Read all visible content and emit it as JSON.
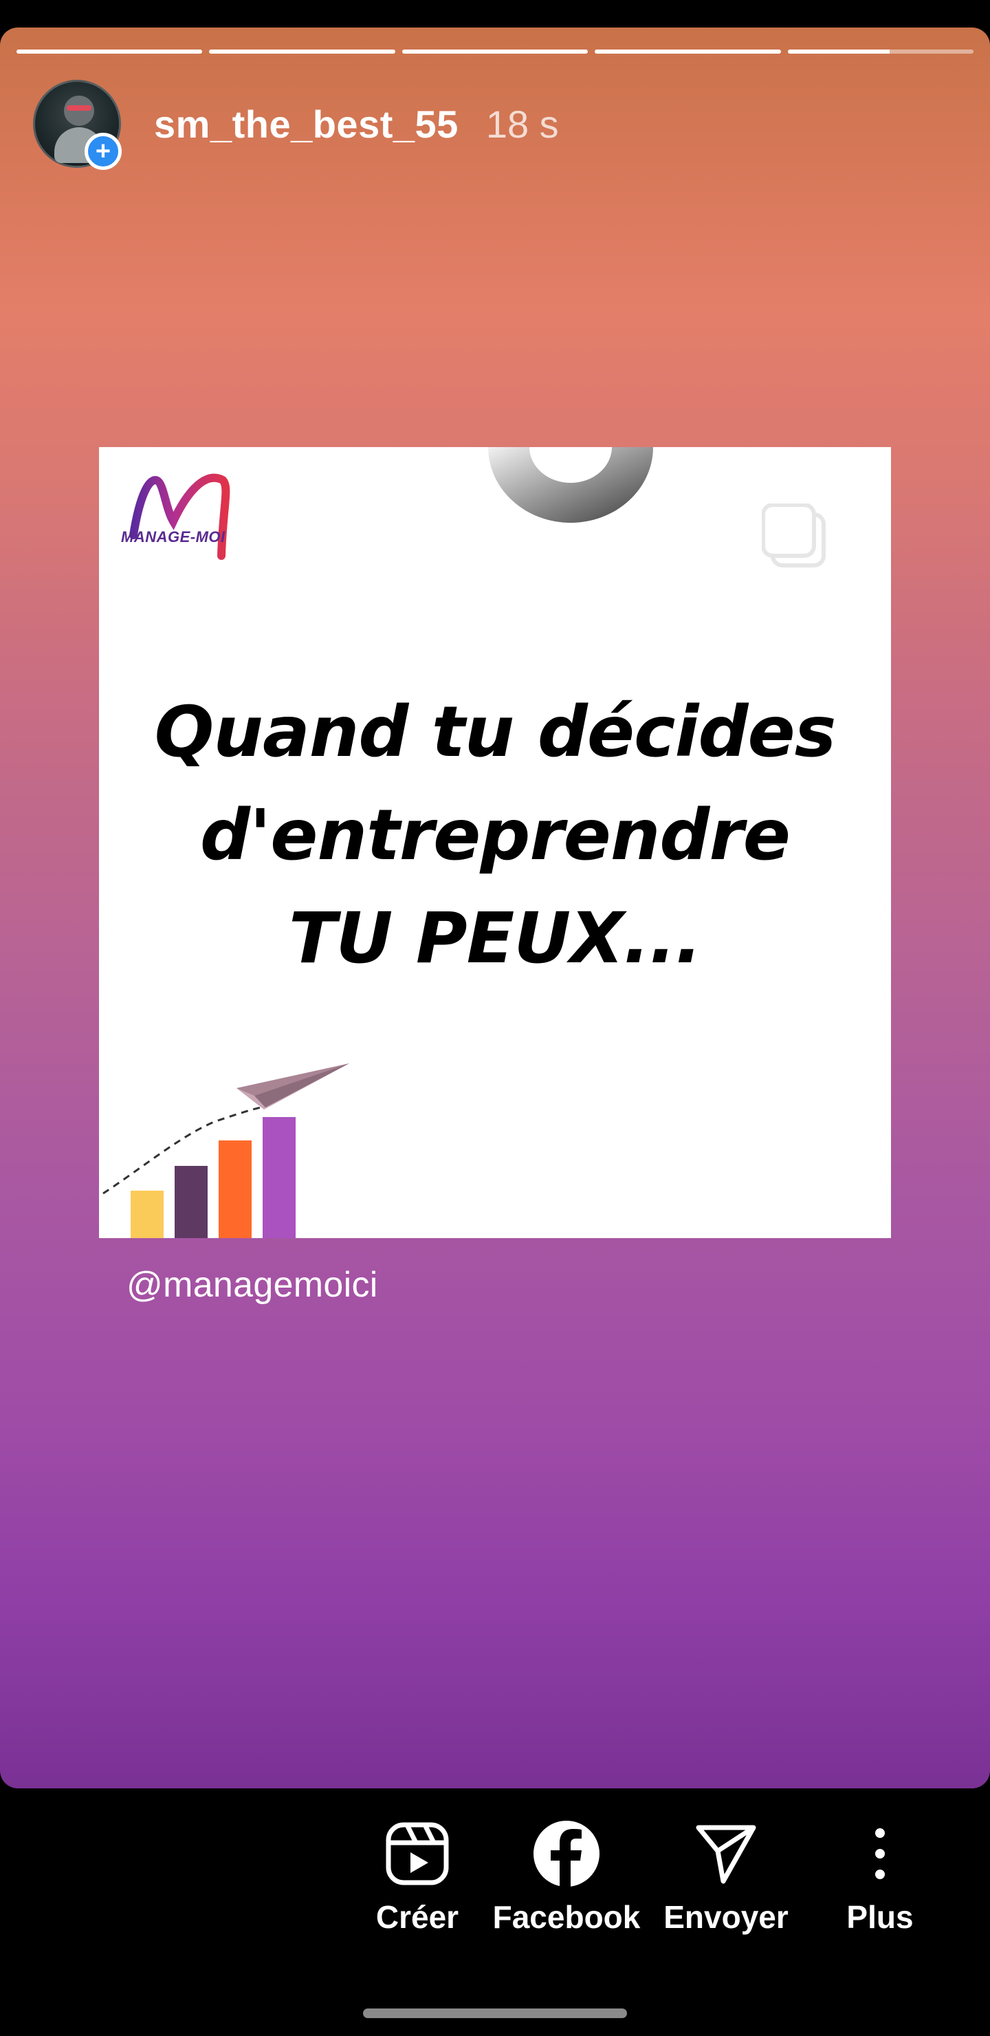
{
  "story": {
    "username": "sm_the_best_55",
    "time_ago": "18 s",
    "progress_segments": [
      1,
      1,
      1,
      1,
      0.55
    ],
    "avatar_badge": "+",
    "mention": "@managemoici"
  },
  "post": {
    "brand_logo_text": "MANAGE-MOI",
    "headline_lines": [
      "Quand tu décides",
      "d'entreprendre",
      "TU PEUX..."
    ],
    "chart_bar_colors": [
      "#fbcb5a",
      "#5e3a63",
      "#ff6a2b",
      "#a952c0"
    ]
  },
  "actions": [
    {
      "label": "Créer",
      "icon": "reels-icon"
    },
    {
      "label": "Facebook",
      "icon": "facebook-icon"
    },
    {
      "label": "Envoyer",
      "icon": "send-icon"
    },
    {
      "label": "Plus",
      "icon": "more-vertical-icon"
    }
  ],
  "colors": {
    "accent_blue": "#2c8df2",
    "text": "#ffffff"
  }
}
